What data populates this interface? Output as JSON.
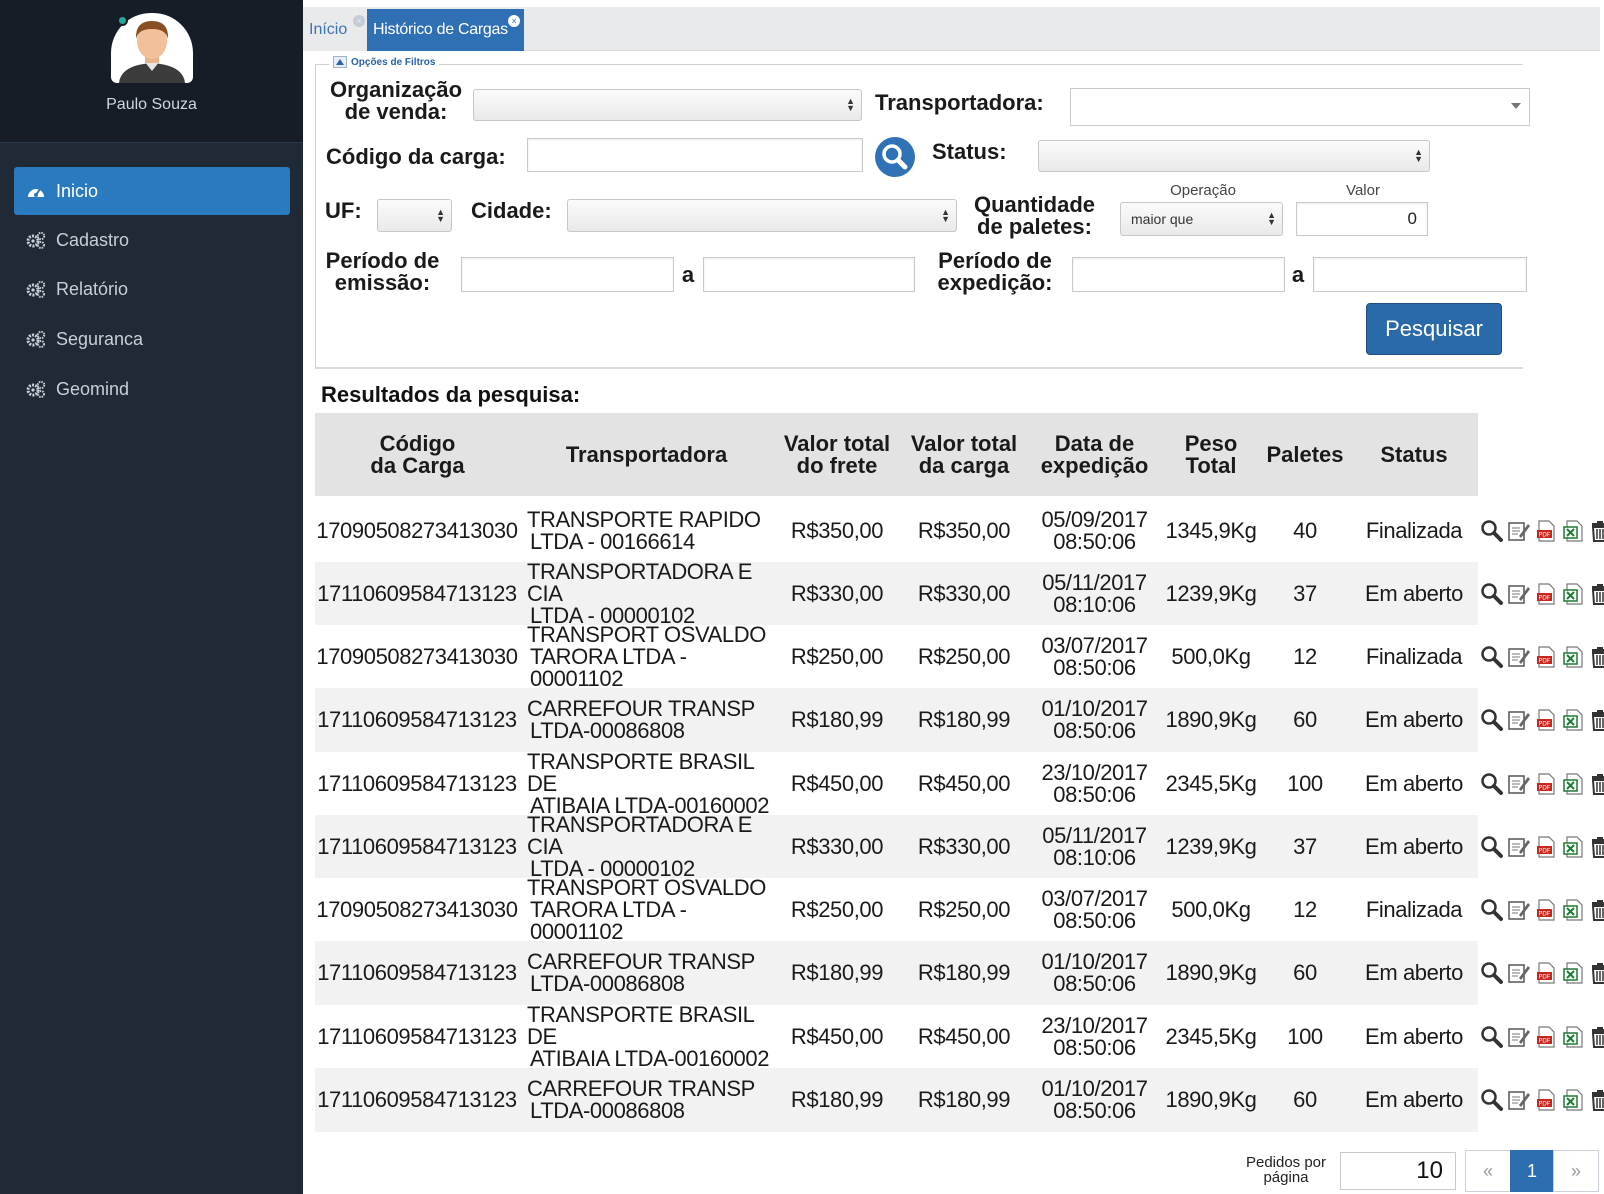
{
  "sidebar": {
    "user_name": "Paulo Souza",
    "items": [
      {
        "label": "Inicio"
      },
      {
        "label": "Cadastro"
      },
      {
        "label": "Relatório"
      },
      {
        "label": "Seguranca"
      },
      {
        "label": "Geomind"
      }
    ]
  },
  "tabs": [
    {
      "label": "Início"
    },
    {
      "label": "Histórico de Cargas"
    }
  ],
  "filters": {
    "legend": "Opções de Filtros",
    "org_label_1": "Organização",
    "org_label_2": "de venda:",
    "transportadora_label": "Transportadora:",
    "codigo_label": "Código da carga:",
    "status_label": "Status:",
    "uf_label": "UF:",
    "cidade_label": "Cidade:",
    "qtd_label_1": "Quantidade",
    "qtd_label_2": "de paletes:",
    "operacao_label": "Operação",
    "operacao_value": "maior que",
    "valor_label": "Valor",
    "valor_value": "0",
    "emissao_label_1": "Período de",
    "emissao_label_2": "emissão:",
    "expedicao_label_1": "Período de",
    "expedicao_label_2": "expedição:",
    "a_label": "a",
    "search_button": "Pesquisar"
  },
  "results": {
    "title": "Resultados da pesquisa:",
    "headers": {
      "codigo_1": "Código",
      "codigo_2": "da Carga",
      "transportadora": "Transportadora",
      "frete_1": "Valor total",
      "frete_2": "do frete",
      "carga_1": "Valor total",
      "carga_2": "da carga",
      "data_1": "Data de",
      "data_2": "expedição",
      "peso_1": "Peso",
      "peso_2": "Total",
      "paletes": "Paletes",
      "status": "Status"
    },
    "rows": [
      {
        "codigo": "17090508273413030",
        "transp_1": "TRANSPORTE RAPIDO",
        "transp_2": "LTDA - 00166614",
        "frete": "R$350,00",
        "carga": "R$350,00",
        "data": "05/09/2017",
        "hora": "08:50:06",
        "peso": "1345,9Kg",
        "paletes": "40",
        "status": "Finalizada"
      },
      {
        "codigo": "17110609584713123",
        "transp_1": "TRANSPORTADORA E CIA",
        "transp_2": "LTDA - 00000102",
        "frete": "R$330,00",
        "carga": "R$330,00",
        "data": "05/11/2017",
        "hora": "08:10:06",
        "peso": "1239,9Kg",
        "paletes": "37",
        "status": "Em aberto"
      },
      {
        "codigo": "17090508273413030",
        "transp_1": "TRANSPORT OSVALDO",
        "transp_2": "TARORA LTDA - 00001102",
        "frete": "R$250,00",
        "carga": "R$250,00",
        "data": "03/07/2017",
        "hora": "08:50:06",
        "peso": "500,0Kg",
        "paletes": "12",
        "status": "Finalizada"
      },
      {
        "codigo": "17110609584713123",
        "transp_1": "CARREFOUR TRANSP",
        "transp_2": "LTDA-00086808",
        "frete": "R$180,99",
        "carga": "R$180,99",
        "data": "01/10/2017",
        "hora": "08:50:06",
        "peso": "1890,9Kg",
        "paletes": "60",
        "status": "Em aberto"
      },
      {
        "codigo": "17110609584713123",
        "transp_1": "TRANSPORTE BRASIL DE",
        "transp_2": "ATIBAIA LTDA-00160002",
        "frete": "R$450,00",
        "carga": "R$450,00",
        "data": "23/10/2017",
        "hora": "08:50:06",
        "peso": "2345,5Kg",
        "paletes": "100",
        "status": "Em aberto"
      },
      {
        "codigo": "17110609584713123",
        "transp_1": "TRANSPORTADORA E CIA",
        "transp_2": "LTDA - 00000102",
        "frete": "R$330,00",
        "carga": "R$330,00",
        "data": "05/11/2017",
        "hora": "08:10:06",
        "peso": "1239,9Kg",
        "paletes": "37",
        "status": "Em aberto"
      },
      {
        "codigo": "17090508273413030",
        "transp_1": "TRANSPORT OSVALDO",
        "transp_2": "TARORA LTDA - 00001102",
        "frete": "R$250,00",
        "carga": "R$250,00",
        "data": "03/07/2017",
        "hora": "08:50:06",
        "peso": "500,0Kg",
        "paletes": "12",
        "status": "Finalizada"
      },
      {
        "codigo": "17110609584713123",
        "transp_1": "CARREFOUR TRANSP",
        "transp_2": "LTDA-00086808",
        "frete": "R$180,99",
        "carga": "R$180,99",
        "data": "01/10/2017",
        "hora": "08:50:06",
        "peso": "1890,9Kg",
        "paletes": "60",
        "status": "Em aberto"
      },
      {
        "codigo": "17110609584713123",
        "transp_1": "TRANSPORTE BRASIL DE",
        "transp_2": "ATIBAIA LTDA-00160002",
        "frete": "R$450,00",
        "carga": "R$450,00",
        "data": "23/10/2017",
        "hora": "08:50:06",
        "peso": "2345,5Kg",
        "paletes": "100",
        "status": "Em aberto"
      },
      {
        "codigo": "17110609584713123",
        "transp_1": "CARREFOUR TRANSP",
        "transp_2": "LTDA-00086808",
        "frete": "R$180,99",
        "carga": "R$180,99",
        "data": "01/10/2017",
        "hora": "08:50:06",
        "peso": "1890,9Kg",
        "paletes": "60",
        "status": "Em aberto"
      }
    ]
  },
  "pagination": {
    "per_page_label_1": "Pedidos por",
    "per_page_label_2": "página",
    "per_page_value": "10",
    "prev": "«",
    "current": "1",
    "next": "»"
  },
  "colors": {
    "sidebar_bg": "#1f2a36",
    "accent": "#2a7ac0",
    "button": "#2b6aa8",
    "header_bg": "#e3e3e3"
  }
}
